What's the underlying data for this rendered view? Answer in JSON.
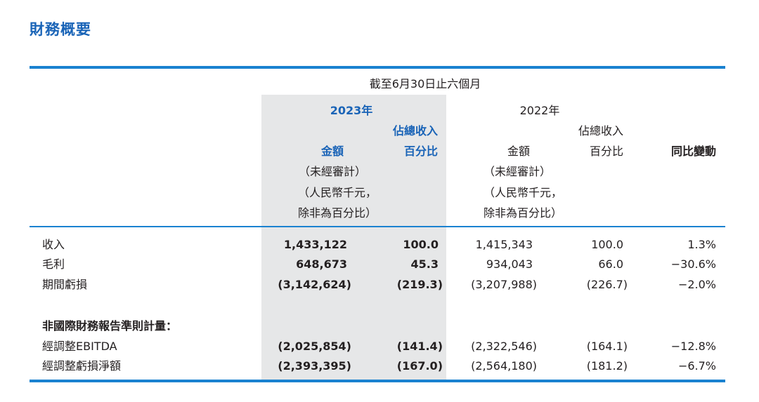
{
  "title": "財務概要",
  "header": {
    "period": "截至6月30日止六個月",
    "year_2023": "2023年",
    "year_2022": "2022年",
    "amount_label": "金額",
    "amount_note1": "（未經審計）",
    "amount_note2": "（人民幣千元，",
    "amount_note3": "除非為百分比）",
    "pct_label1": "佔總收入",
    "pct_label2": "百分比",
    "yoy_label": "同比變動"
  },
  "rows": [
    {
      "label": "收入",
      "amt_2023": "1,433,122",
      "pct_2023": "100.0",
      "amt_2022": "1,415,343",
      "pct_2022": "100.0",
      "yoy": "1.3%"
    },
    {
      "label": "毛利",
      "amt_2023": "648,673",
      "pct_2023": "45.3",
      "amt_2022": "934,043",
      "pct_2022": "66.0",
      "yoy": "−30.6%"
    },
    {
      "label": "期間虧損",
      "amt_2023": "(3,142,624)",
      "pct_2023": "(219.3)",
      "amt_2022": "(3,207,988)",
      "pct_2022": "(226.7)",
      "yoy": "−2.0%"
    }
  ],
  "non_ifrs_heading": "非國際財務報告準則計量：",
  "non_ifrs_rows": [
    {
      "label": "經調整EBITDA",
      "amt_2023": "(2,025,854)",
      "pct_2023": "(141.4)",
      "amt_2022": "(2,322,546)",
      "pct_2022": "(164.1)",
      "yoy": "−12.8%"
    },
    {
      "label": "經調整虧損淨額",
      "amt_2023": "(2,393,395)",
      "pct_2023": "(167.0)",
      "amt_2022": "(2,564,180)",
      "pct_2022": "(181.2)",
      "yoy": "−6.7%"
    }
  ],
  "colors": {
    "accent": "#1a64b7",
    "rule": "#1a82d0",
    "shade": "#e6e7e8"
  }
}
